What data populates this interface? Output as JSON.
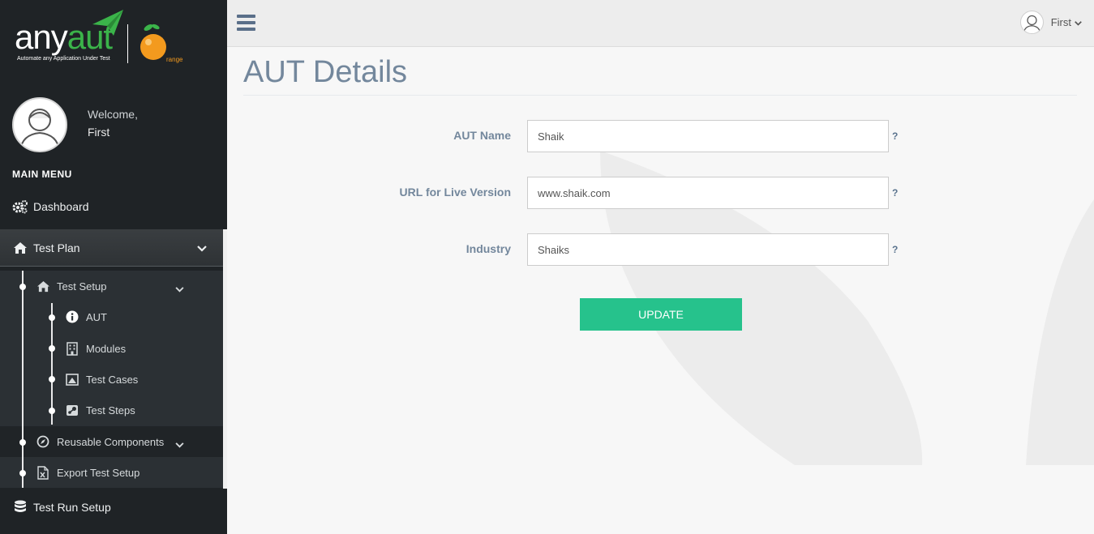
{
  "brand": {
    "logo_prefix": "any",
    "logo_suffix": "aut",
    "tagline": "Automate any Application Under Test",
    "partner_suffix": "range",
    "accent_color": "#3bb44a",
    "partner_color": "#f39a1e"
  },
  "profile": {
    "welcome": "Welcome,",
    "name": "First"
  },
  "sidebar": {
    "menu_title": "MAIN MENU",
    "dashboard": "Dashboard",
    "test_plan": "Test Plan",
    "test_setup": "Test Setup",
    "items": [
      {
        "label": "AUT",
        "icon": "info-icon"
      },
      {
        "label": "Modules",
        "icon": "building-icon"
      },
      {
        "label": "Test Cases",
        "icon": "image-icon"
      },
      {
        "label": "Test Steps",
        "icon": "steam-icon"
      }
    ],
    "reusable_components": "Reusable Components",
    "export_test_setup": "Export Test Setup",
    "test_run_setup": "Test Run Setup"
  },
  "topbar": {
    "user_name": "First"
  },
  "main": {
    "title": "AUT Details",
    "fields": [
      {
        "label": "AUT Name",
        "value": "Shaik",
        "help": "?"
      },
      {
        "label": "URL for Live Version",
        "value": "www.shaik.com",
        "help": "?"
      },
      {
        "label": "Industry",
        "value": "Shaiks",
        "help": "?"
      }
    ],
    "update_label": "UPDATE",
    "button_color": "#26c28c"
  }
}
